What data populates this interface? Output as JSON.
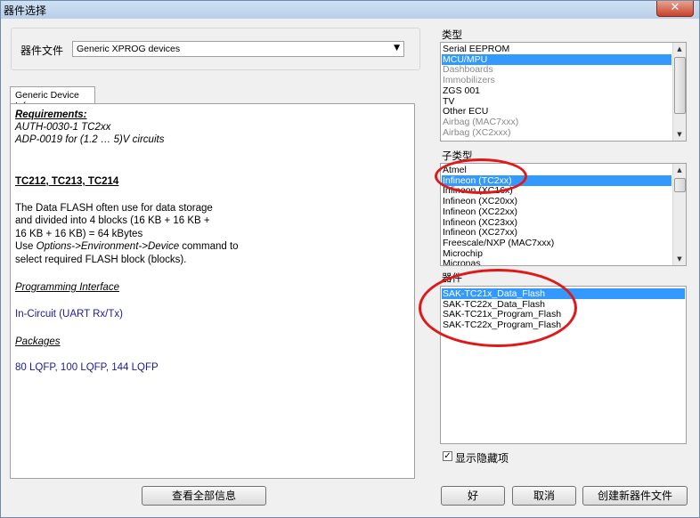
{
  "window": {
    "title": "器件选择",
    "close_glyph": "✕"
  },
  "device_file": {
    "label": "器件文件",
    "value": "Generic XPROG devices"
  },
  "info_tab": {
    "label": "Generic Device Info"
  },
  "info": {
    "requirements_title": "Requirements:",
    "req_line1": "AUTH-0030-1 TC2xx",
    "req_line2": "ADP-0019 for (1.2 … 5)V circuits",
    "devices_title": "TC212, TC213, TC214",
    "desc_line1": "The Data FLASH often use for data storage",
    "desc_line2": "and divided into 4 blocks (16 KB + 16 KB +",
    "desc_line3": "16 KB + 16 KB) = 64 kBytes",
    "desc_line4_prefix": "Use ",
    "desc_line4_path": "Options->Environment->Device",
    "desc_line4_suffix": " command to",
    "desc_line5": "select required FLASH block (blocks).",
    "prog_title": "Programming Interface",
    "prog_value": "In-Circuit (UART Rx/Tx)",
    "pkg_title": "Packages",
    "pkg_value": "80 LQFP, 100 LQFP, 144 LQFP"
  },
  "view_all_button": "查看全部信息",
  "type_section": {
    "label": "类型",
    "items": [
      {
        "label": "Serial EEPROM",
        "state": "normal"
      },
      {
        "label": "MCU/MPU",
        "state": "selected"
      },
      {
        "label": "Dashboards",
        "state": "disabled"
      },
      {
        "label": "Immobilizers",
        "state": "disabled"
      },
      {
        "label": "ZGS 001",
        "state": "normal"
      },
      {
        "label": "TV",
        "state": "normal"
      },
      {
        "label": "Other ECU",
        "state": "normal"
      },
      {
        "label": "Airbag (MAC7xxx)",
        "state": "disabled"
      },
      {
        "label": "Airbag (XC2xxx)",
        "state": "disabled"
      }
    ]
  },
  "subtype_section": {
    "label": "子类型",
    "items": [
      {
        "label": "Atmel",
        "state": "normal"
      },
      {
        "label": "Infineon (TC2xx)",
        "state": "selected"
      },
      {
        "label": "Infineon (XC16x)",
        "state": "normal"
      },
      {
        "label": "Infineon (XC20xx)",
        "state": "normal"
      },
      {
        "label": "Infineon (XC22xx)",
        "state": "normal"
      },
      {
        "label": "Infineon (XC23xx)",
        "state": "normal"
      },
      {
        "label": "Infineon (XC27xx)",
        "state": "normal"
      },
      {
        "label": "Freescale/NXP (MAC7xxx)",
        "state": "normal"
      },
      {
        "label": "Microchip",
        "state": "normal"
      },
      {
        "label": "Micronas",
        "state": "normal"
      }
    ]
  },
  "device_section": {
    "label": "器件",
    "items": [
      {
        "label": "SAK-TC21x_Data_Flash",
        "state": "selected"
      },
      {
        "label": "SAK-TC22x_Data_Flash",
        "state": "normal"
      },
      {
        "label": "SAK-TC21x_Program_Flash",
        "state": "normal"
      },
      {
        "label": "SAK-TC22x_Program_Flash",
        "state": "normal"
      }
    ]
  },
  "show_hidden": {
    "label": "显示隐藏项",
    "checked": true,
    "check_glyph": "✓"
  },
  "buttons": {
    "ok": "好",
    "cancel": "取消",
    "create": "创建新器件文件"
  },
  "colors": {
    "selection": "#3399ff",
    "highlight_circle": "#e01818",
    "info_blue": "#1a1aa0"
  }
}
